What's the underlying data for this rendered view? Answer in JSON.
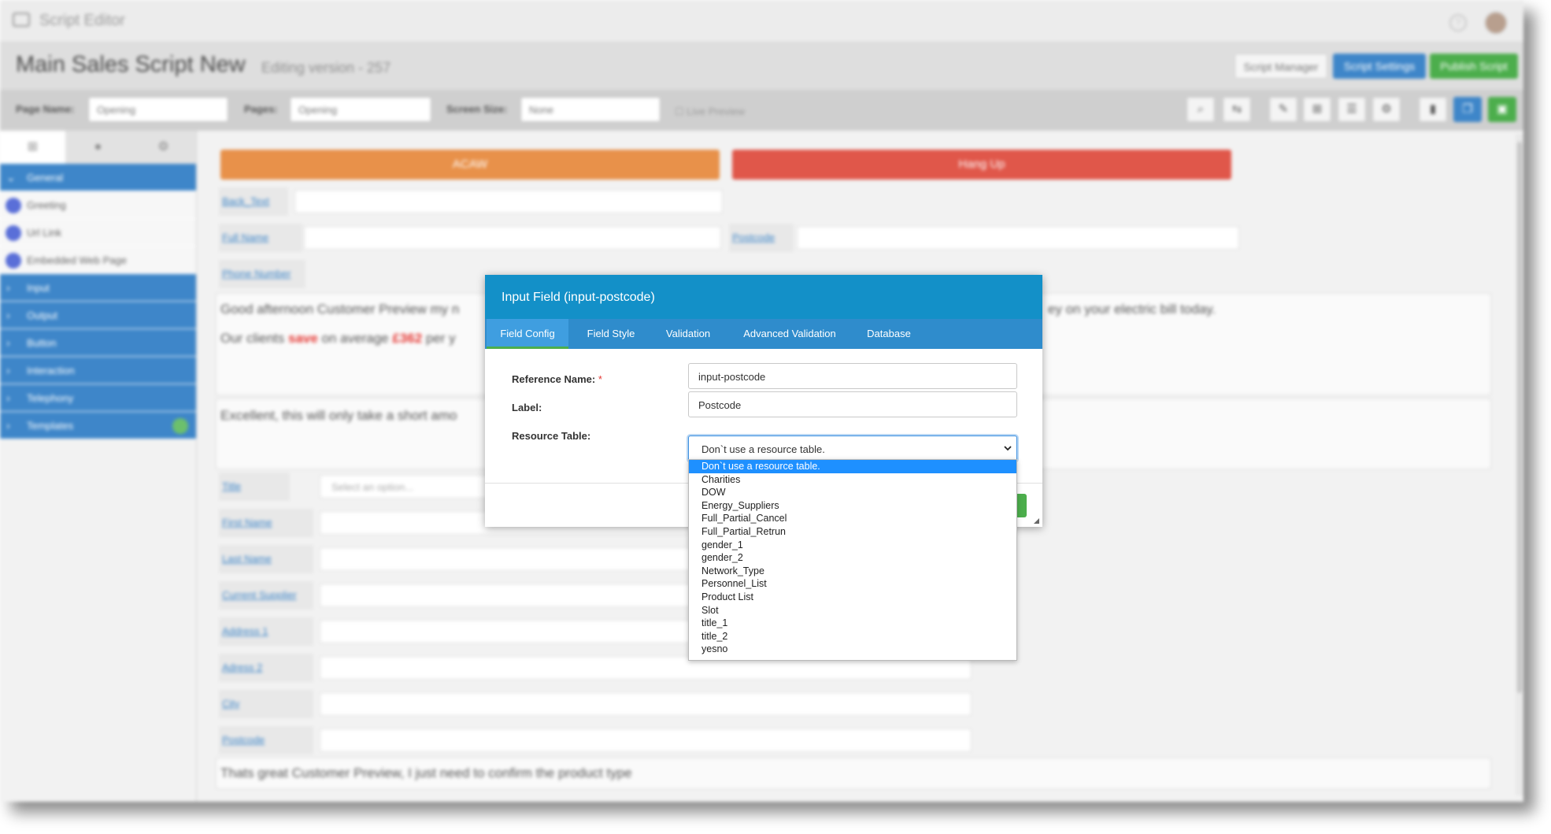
{
  "app": {
    "title": "Script Editor",
    "help_icon": "?",
    "script_name": "Main Sales Script New",
    "version_text": "Editing version - 257",
    "buttons": {
      "manager": "Script Manager",
      "settings": "Script Settings",
      "publish": "Publish Script"
    }
  },
  "toolbar": {
    "page_name_label": "Page Name:",
    "page_name_value": "Opening",
    "pages_label": "Pages:",
    "pages_value": "Opening",
    "screen_size_label": "Screen Size:",
    "screen_size_value": "None",
    "live_preview_label": "Live Preview"
  },
  "sidebar": {
    "items": [
      {
        "label": "General",
        "type": "group",
        "expanded": true
      },
      {
        "label": "Greeting",
        "type": "child"
      },
      {
        "label": "Url Link",
        "type": "child"
      },
      {
        "label": "Embedded Web Page",
        "type": "child"
      },
      {
        "label": "Input",
        "type": "group"
      },
      {
        "label": "Output",
        "type": "group"
      },
      {
        "label": "Button",
        "type": "group"
      },
      {
        "label": "Interaction",
        "type": "group"
      },
      {
        "label": "Telephony",
        "type": "group"
      },
      {
        "label": "Templates",
        "type": "group"
      }
    ]
  },
  "canvas": {
    "action_button": "ACAW",
    "hangup_button": "Hang Up",
    "fields_top": [
      "Back_Text",
      "Full Name",
      "Postcode",
      "Phone Number"
    ],
    "text1_part1": "Good afternoon Customer Preview my n",
    "text1_end": "ey on your electric bill today.",
    "text2_prefix": "Our clients ",
    "text2_save": "save",
    "text2_mid": " on average ",
    "text2_amount": "£362",
    "text2_suffix": " per y",
    "text3": "Excellent, this will only take a short amo",
    "title_placeholder": "Select an option...",
    "fields_bottom": [
      "Title",
      "First Name",
      "Last Name",
      "Current Supplier",
      "Address 1",
      "Adress 2",
      "City",
      "Postcode"
    ],
    "text4": "Thats great Customer Preview, I just need to confirm the product type"
  },
  "modal": {
    "title": "Input Field (input-postcode)",
    "tabs": [
      "Field Config",
      "Field Style",
      "Validation",
      "Advanced Validation",
      "Database"
    ],
    "active_tab": "Field Config",
    "reference_name_label": "Reference Name:",
    "required_mark": "*",
    "reference_name_value": "input-postcode",
    "label_label": "Label:",
    "label_value": "Postcode",
    "resource_table_label": "Resource Table:",
    "resource_table_value": "Don`t use a resource table."
  },
  "dropdown": {
    "selected": "Don`t use a resource table.",
    "options": [
      "Don`t use a resource table.",
      "Charities",
      "DOW",
      "Energy_Suppliers",
      "Full_Partial_Cancel",
      "Full_Partial_Retrun",
      "gender_1",
      "gender_2",
      "Network_Type",
      "Personnel_List",
      "Product List",
      "Slot",
      "title_1",
      "title_2",
      "yesno"
    ]
  },
  "colors": {
    "modal_header": "#1390c8",
    "modal_tabs": "#2f8ccc",
    "selected_option": "#1e90ff",
    "orange_button": "#e8914a",
    "red_button": "#e0574a",
    "sidebar_blue": "#3e86c9"
  }
}
